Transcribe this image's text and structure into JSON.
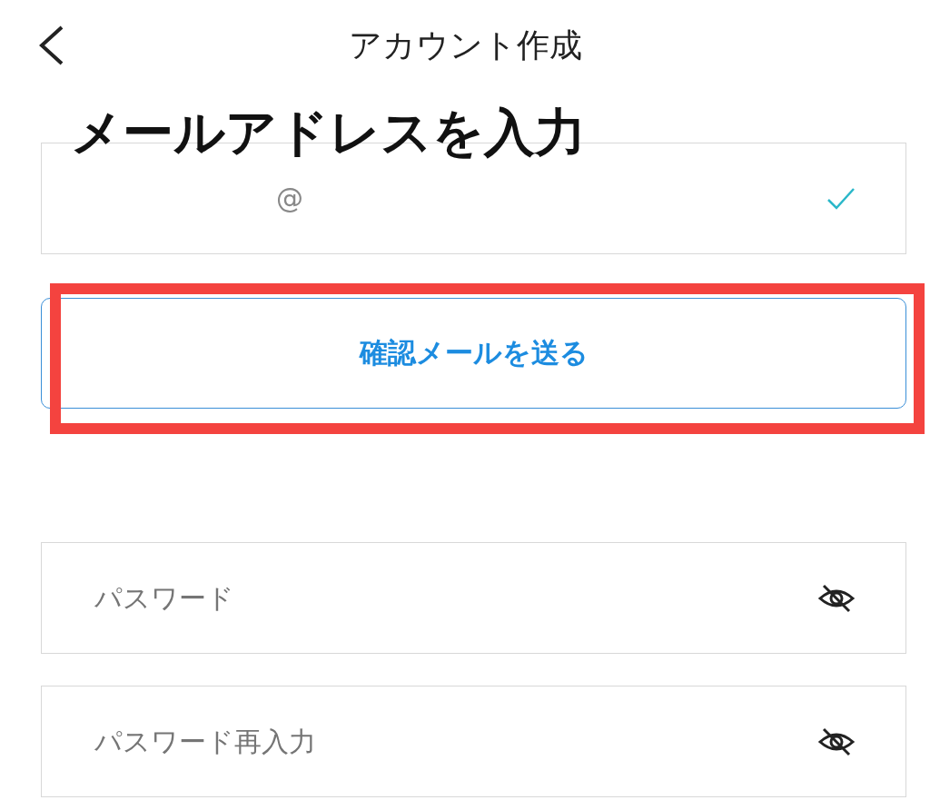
{
  "header": {
    "title": "アカウント作成"
  },
  "annotation": {
    "label": "メールアドレスを入力"
  },
  "email_field": {
    "value": "@",
    "valid": true
  },
  "send_button": {
    "label": "確認メールを送る",
    "highlighted": true
  },
  "password_fields": [
    {
      "placeholder": "パスワード",
      "visible": false
    },
    {
      "placeholder": "パスワード再入力",
      "visible": false
    }
  ]
}
